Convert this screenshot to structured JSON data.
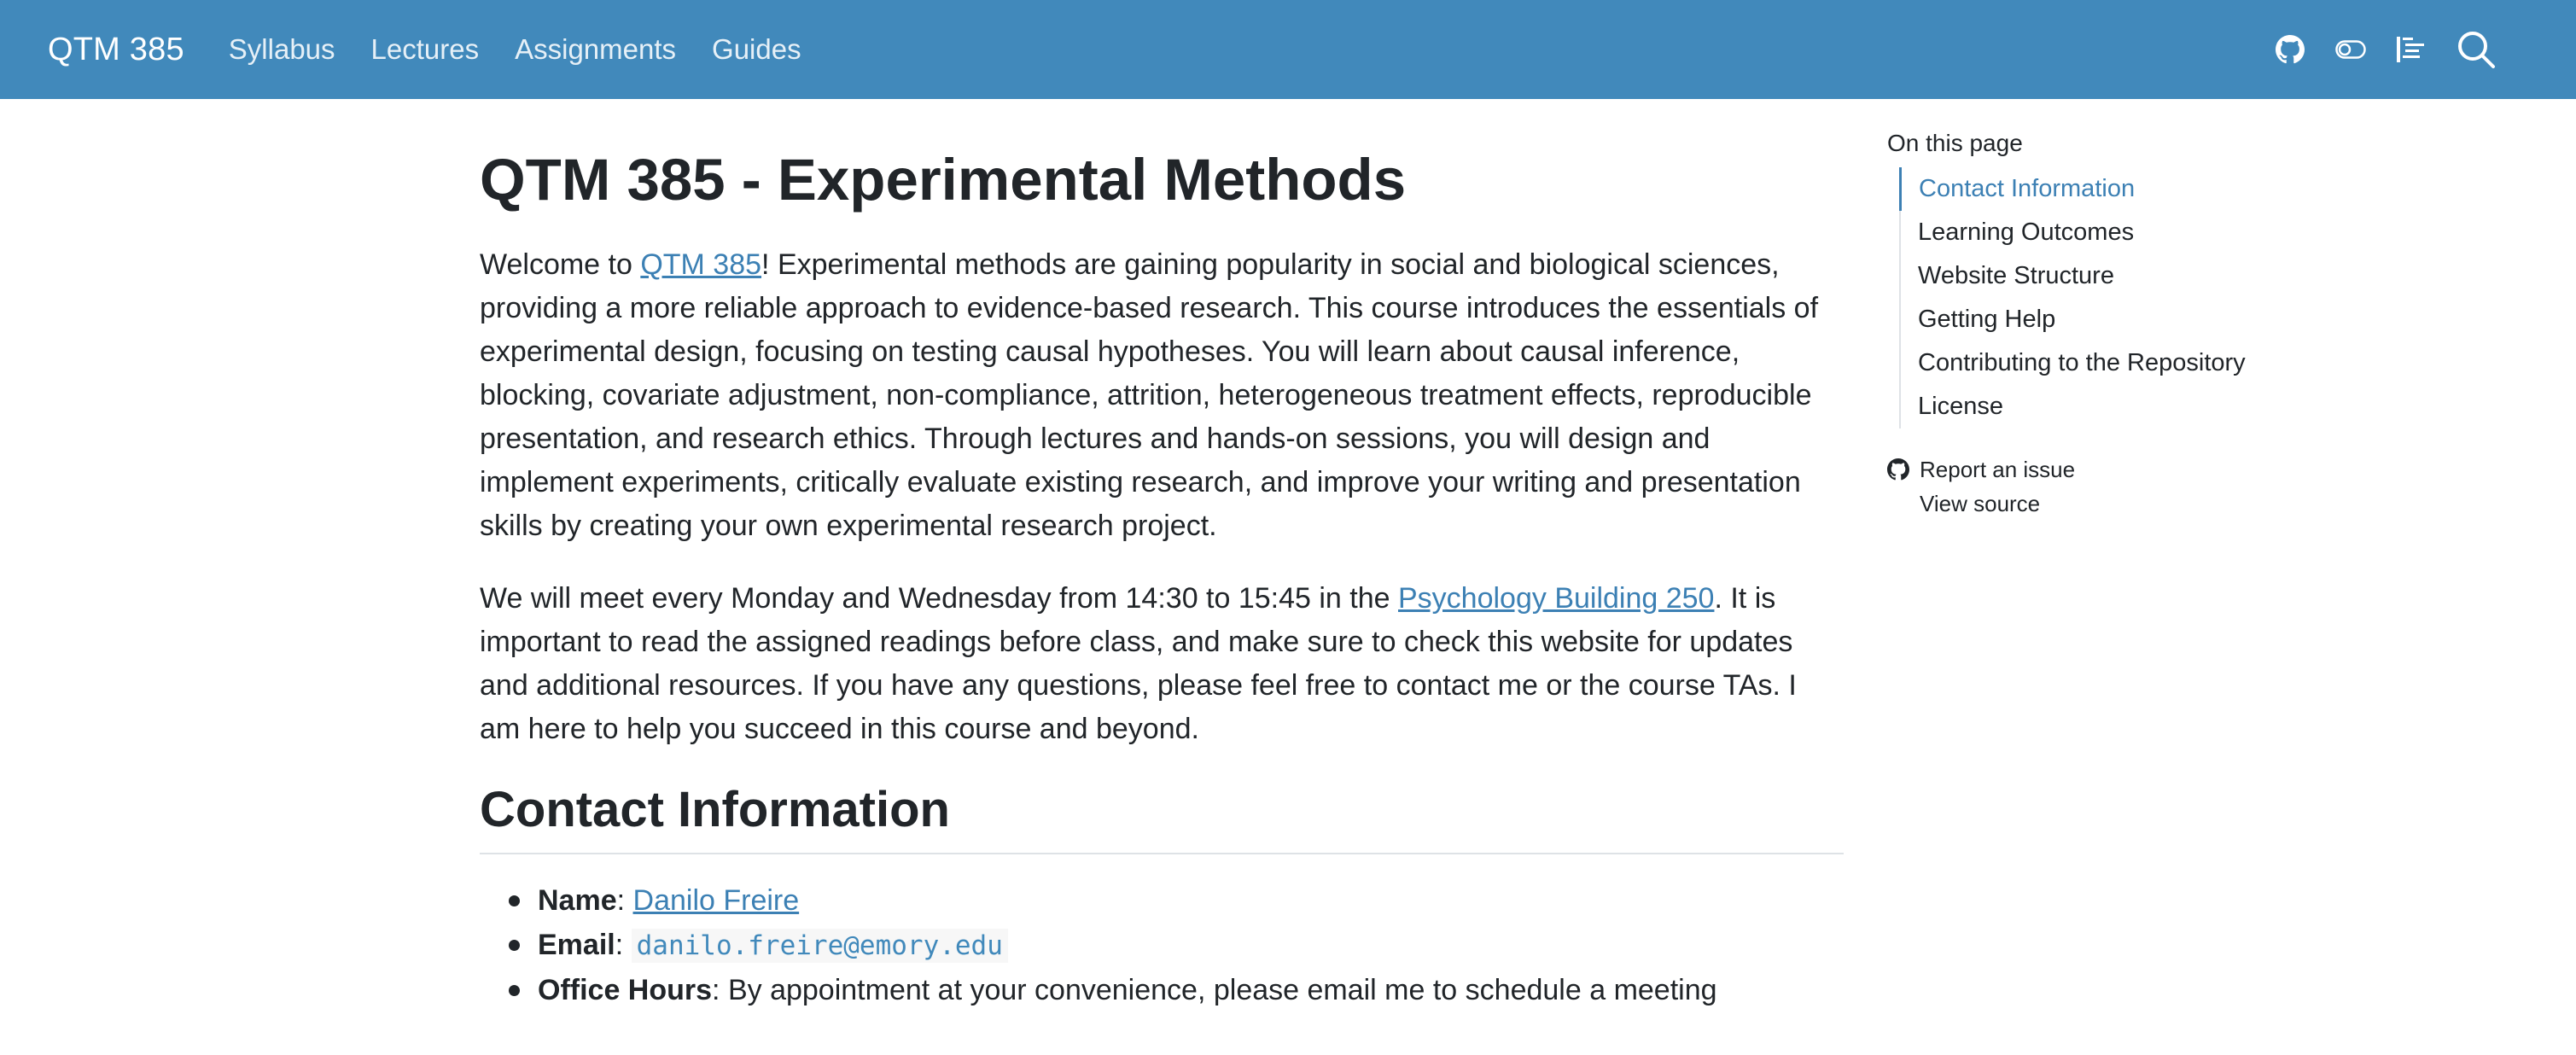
{
  "navbar": {
    "brand": "QTM 385",
    "links": [
      "Syllabus",
      "Lectures",
      "Assignments",
      "Guides"
    ],
    "tools": [
      "github-icon",
      "toggle-icon",
      "reader-mode-icon",
      "search-icon"
    ]
  },
  "main": {
    "title": "QTM 385 - Experimental Methods",
    "intro": {
      "prefix": "Welcome to ",
      "link": "QTM 385",
      "text": "! Experimental methods are gaining popularity in social and biological sciences, providing a more reliable approach to evidence-based research. This course introduces the essentials of experimental design, focusing on testing causal hypotheses. You will learn about causal inference, blocking, covariate adjustment, non-compliance, attrition, heterogeneous treatment effects, reproducible presentation, and research ethics. Through lectures and hands-on sessions, you will design and implement experiments, critically evaluate existing research, and improve your writing and presentation skills by creating your own experimental research project."
    },
    "meeting": {
      "prefix": "We will meet every Monday and Wednesday from 14:30 to 15:45 in the ",
      "link": "Psychology Building 250",
      "text": ". It is important to read the assigned readings before class, and make sure to check this website for updates and additional resources. If you have any questions, please feel free to contact me or the course TAs. I am here to help you succeed in this course and beyond."
    },
    "contact": {
      "heading": "Contact Information",
      "name_label": "Name",
      "name_value": "Danilo Freire",
      "email_label": "Email",
      "email_value": "danilo.freire@emory.edu",
      "hours_label": "Office Hours",
      "hours_value": "By appointment at your convenience, please email me to schedule a meeting"
    }
  },
  "toc": {
    "heading": "On this page",
    "items": [
      "Contact Information",
      "Learning Outcomes",
      "Website Structure",
      "Getting Help",
      "Contributing to the Repository",
      "License"
    ],
    "active_index": 0,
    "report_issue": "Report an issue",
    "view_source": "View source"
  },
  "colors": {
    "navbar": "#4189bb",
    "link": "#3c80b4",
    "text": "#212529"
  }
}
